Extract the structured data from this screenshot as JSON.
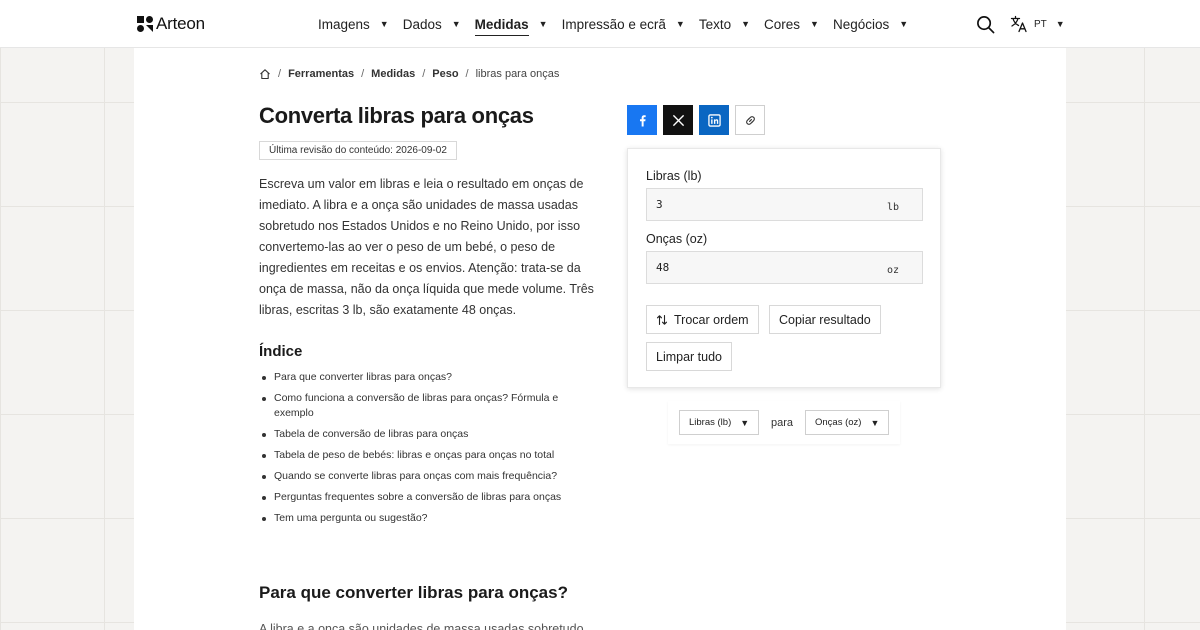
{
  "header": {
    "logo": "Arteon",
    "nav": [
      {
        "label": "Imagens",
        "active": false
      },
      {
        "label": "Dados",
        "active": false
      },
      {
        "label": "Medidas",
        "active": true
      },
      {
        "label": "Impressão e ecrã",
        "active": false
      },
      {
        "label": "Texto",
        "active": false
      },
      {
        "label": "Cores",
        "active": false
      },
      {
        "label": "Negócios",
        "active": false
      }
    ],
    "lang": "PT"
  },
  "breadcrumb": [
    "Ferramentas",
    "Medidas",
    "Peso",
    "libras para onças"
  ],
  "title": "Converta libras para onças",
  "revision": "Última revisão do conteúdo: 2026-09-02",
  "intro": "Escreva um valor em libras e leia o resultado em onças de imediato. A libra e a onça são unidades de massa usadas sobretudo nos Estados Unidos e no Reino Unido, por isso convertemo-las ao ver o peso de um bebé, o peso de ingredientes em receitas e os envios. Atenção: trata-se da onça de massa, não da onça líquida que mede volume. Três libras, escritas 3 lb, são exatamente 48 onças.",
  "toc": {
    "title": "Índice",
    "items": [
      "Para que converter libras para onças?",
      "Como funciona a conversão de libras para onças? Fórmula e exemplo",
      "Tabela de conversão de libras para onças",
      "Tabela de peso de bebés: libras e onças para onças no total",
      "Quando se converte libras para onças com mais frequência?",
      "Perguntas frequentes sobre a conversão de libras para onças",
      "Tem uma pergunta ou sugestão?"
    ]
  },
  "section": {
    "title": "Para que converter libras para onças?",
    "text": "A libra e a onça são unidades de massa usadas sobretudo"
  },
  "converter": {
    "from_label": "Libras (lb)",
    "from_value": "3",
    "from_unit": "lb",
    "to_label": "Onças (oz)",
    "to_value": "48",
    "to_unit": "oz",
    "swap_label": "Trocar ordem",
    "copy_label": "Copiar resultado",
    "clear_label": "Limpar tudo"
  },
  "unit_selector": {
    "from": "Libras (lb)",
    "connector": "para",
    "to": "Onças (oz)"
  },
  "colors": {
    "facebook": "#1877f2",
    "x": "#111111",
    "linkedin": "#0a66c2"
  }
}
